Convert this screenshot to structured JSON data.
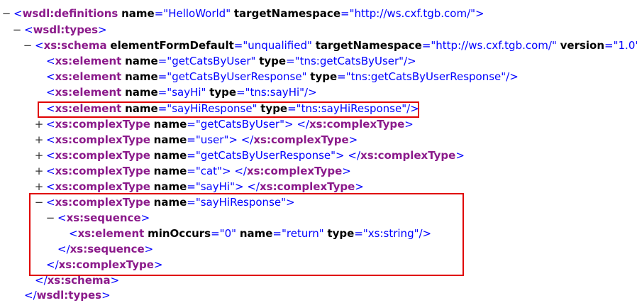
{
  "xml": {
    "lines": [
      {
        "toggle": "−",
        "open": "<",
        "tag": "wsdl:definitions",
        "attrs": [
          {
            "name": "name",
            "value": "HelloWorld"
          },
          {
            "name": "targetNamespace",
            "value": "http://ws.cxf.tgb.com/"
          }
        ],
        "close": ">"
      },
      {
        "toggle": "−",
        "open": "<",
        "tag": "wsdl:types",
        "close": ">"
      },
      {
        "toggle": "−",
        "open": "<",
        "tag": "xs:schema",
        "attrs": [
          {
            "name": "elementFormDefault",
            "value": "unqualified"
          },
          {
            "name": "targetNamespace",
            "value": "http://ws.cxf.tgb.com/"
          },
          {
            "name": "version",
            "value": "1.0"
          }
        ],
        "close": ">"
      },
      {
        "open": "<",
        "tag": "xs:element",
        "attrs": [
          {
            "name": "name",
            "value": "getCatsByUser"
          },
          {
            "name": "type",
            "value": "tns:getCatsByUser"
          }
        ],
        "close": "/>"
      },
      {
        "open": "<",
        "tag": "xs:element",
        "attrs": [
          {
            "name": "name",
            "value": "getCatsByUserResponse"
          },
          {
            "name": "type",
            "value": "tns:getCatsByUserResponse"
          }
        ],
        "close": "/>"
      },
      {
        "open": "<",
        "tag": "xs:element",
        "attrs": [
          {
            "name": "name",
            "value": "sayHi"
          },
          {
            "name": "type",
            "value": "tns:sayHi"
          }
        ],
        "close": "/>"
      },
      {
        "open": "<",
        "tag": "xs:element",
        "attrs": [
          {
            "name": "name",
            "value": "sayHiResponse"
          },
          {
            "name": "type",
            "value": "tns:sayHiResponse"
          }
        ],
        "close": "/>"
      },
      {
        "toggle": "+",
        "open": "<",
        "tag": "xs:complexType",
        "attrs": [
          {
            "name": "name",
            "value": "getCatsByUser"
          }
        ],
        "close": ">",
        "endOpen": "</",
        "endTag": "xs:complexType",
        "endClose": ">"
      },
      {
        "toggle": "+",
        "open": "<",
        "tag": "xs:complexType",
        "attrs": [
          {
            "name": "name",
            "value": "user"
          }
        ],
        "close": ">",
        "endOpen": "</",
        "endTag": "xs:complexType",
        "endClose": ">"
      },
      {
        "toggle": "+",
        "open": "<",
        "tag": "xs:complexType",
        "attrs": [
          {
            "name": "name",
            "value": "getCatsByUserResponse"
          }
        ],
        "close": ">",
        "endOpen": "</",
        "endTag": "xs:complexType",
        "endClose": ">"
      },
      {
        "toggle": "+",
        "open": "<",
        "tag": "xs:complexType",
        "attrs": [
          {
            "name": "name",
            "value": "cat"
          }
        ],
        "close": ">",
        "endOpen": "</",
        "endTag": "xs:complexType",
        "endClose": ">"
      },
      {
        "toggle": "+",
        "open": "<",
        "tag": "xs:complexType",
        "attrs": [
          {
            "name": "name",
            "value": "sayHi"
          }
        ],
        "close": ">",
        "endOpen": "</",
        "endTag": "xs:complexType",
        "endClose": ">"
      },
      {
        "toggle": "−",
        "open": "<",
        "tag": "xs:complexType",
        "attrs": [
          {
            "name": "name",
            "value": "sayHiResponse"
          }
        ],
        "close": ">"
      },
      {
        "toggle": "−",
        "open": "<",
        "tag": "xs:sequence",
        "close": ">"
      },
      {
        "open": "<",
        "tag": "xs:element",
        "attrs": [
          {
            "name": "minOccurs",
            "value": "0"
          },
          {
            "name": "name",
            "value": "return"
          },
          {
            "name": "type",
            "value": "xs:string"
          }
        ],
        "close": "/>"
      },
      {
        "open": "</",
        "tag": "xs:sequence",
        "close": ">"
      },
      {
        "open": "</",
        "tag": "xs:complexType",
        "close": ">"
      },
      {
        "open": "</",
        "tag": "xs:schema",
        "close": ">"
      },
      {
        "open": "</",
        "tag": "wsdl:types",
        "close": ">"
      }
    ]
  },
  "colors": {
    "tag": "#8b1a8b",
    "attr_value": "#0000ff",
    "highlight": "#e00000"
  }
}
